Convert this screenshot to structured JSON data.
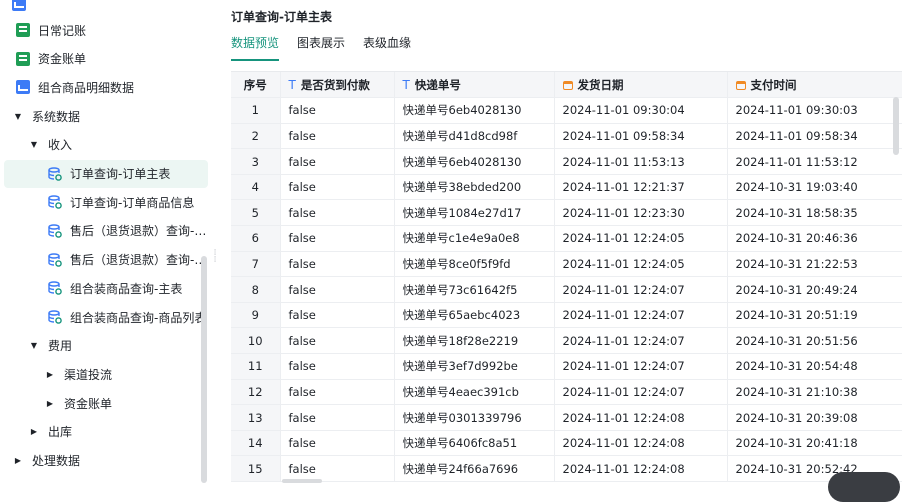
{
  "sidebar": {
    "items": [
      {
        "label": "日常记账",
        "icon": "sheet-icon",
        "caret": "",
        "level": 0,
        "selected": false
      },
      {
        "label": "资金账单",
        "icon": "sheet-icon",
        "caret": "",
        "level": 0,
        "selected": false
      },
      {
        "label": "组合商品明细数据",
        "icon": "chart-icon",
        "caret": "",
        "level": 0,
        "selected": false
      },
      {
        "label": "系统数据",
        "icon": "",
        "caret": "▼",
        "level": 0,
        "selected": false
      },
      {
        "label": "收入",
        "icon": "",
        "caret": "▼",
        "level": 1,
        "selected": false
      },
      {
        "label": "订单查询-订单主表",
        "icon": "db-icon",
        "caret": "",
        "level": 2,
        "selected": true
      },
      {
        "label": "订单查询-订单商品信息",
        "icon": "db-icon",
        "caret": "",
        "level": 2,
        "selected": false
      },
      {
        "label": "售后（退货退款）查询-退货单主表",
        "icon": "db-icon",
        "caret": "",
        "level": 2,
        "selected": false
      },
      {
        "label": "售后（退货退款）查询-退货商品信息",
        "icon": "db-icon",
        "caret": "",
        "level": 2,
        "selected": false
      },
      {
        "label": "组合装商品查询-主表",
        "icon": "db-icon",
        "caret": "",
        "level": 2,
        "selected": false
      },
      {
        "label": "组合装商品查询-商品列表",
        "icon": "db-icon",
        "caret": "",
        "level": 2,
        "selected": false
      },
      {
        "label": "费用",
        "icon": "",
        "caret": "▼",
        "level": 1,
        "selected": false
      },
      {
        "label": "渠道投流",
        "icon": "",
        "caret": "▶",
        "level": 2,
        "selected": false
      },
      {
        "label": "资金账单",
        "icon": "",
        "caret": "▶",
        "level": 2,
        "selected": false
      },
      {
        "label": "出库",
        "icon": "",
        "caret": "▶",
        "level": 1,
        "selected": false
      },
      {
        "label": "处理数据",
        "icon": "",
        "caret": "▶",
        "level": 0,
        "selected": false
      }
    ]
  },
  "main": {
    "title": "订单查询-订单主表",
    "tabs": [
      {
        "label": "数据预览",
        "active": true
      },
      {
        "label": "图表展示",
        "active": false
      },
      {
        "label": "表级血缘",
        "active": false
      }
    ]
  },
  "table": {
    "columns": [
      {
        "label": "序号",
        "type": ""
      },
      {
        "label": "是否货到付款",
        "type": "text"
      },
      {
        "label": "快递单号",
        "type": "text"
      },
      {
        "label": "发货日期",
        "type": "date"
      },
      {
        "label": "支付时间",
        "type": "date"
      }
    ],
    "rows": [
      [
        "1",
        "false",
        "快递单号6eb4028130",
        "2024-11-01 09:30:04",
        "2024-11-01 09:30:03"
      ],
      [
        "2",
        "false",
        "快递单号d41d8cd98f",
        "2024-11-01 09:58:34",
        "2024-11-01 09:58:34"
      ],
      [
        "3",
        "false",
        "快递单号6eb4028130",
        "2024-11-01 11:53:13",
        "2024-11-01 11:53:12"
      ],
      [
        "4",
        "false",
        "快递单号38ebded200",
        "2024-11-01 12:21:37",
        "2024-10-31 19:03:40"
      ],
      [
        "5",
        "false",
        "快递单号1084e27d17",
        "2024-11-01 12:23:30",
        "2024-10-31 18:58:35"
      ],
      [
        "6",
        "false",
        "快递单号c1e4e9a0e8",
        "2024-11-01 12:24:05",
        "2024-10-31 20:46:36"
      ],
      [
        "7",
        "false",
        "快递单号8ce0f5f9fd",
        "2024-11-01 12:24:05",
        "2024-10-31 21:22:53"
      ],
      [
        "8",
        "false",
        "快递单号73c61642f5",
        "2024-11-01 12:24:07",
        "2024-10-31 20:49:24"
      ],
      [
        "9",
        "false",
        "快递单号65aebc4023",
        "2024-11-01 12:24:07",
        "2024-10-31 20:51:19"
      ],
      [
        "10",
        "false",
        "快递单号18f28e2219",
        "2024-11-01 12:24:07",
        "2024-10-31 20:51:56"
      ],
      [
        "11",
        "false",
        "快递单号3ef7d992be",
        "2024-11-01 12:24:07",
        "2024-10-31 20:54:48"
      ],
      [
        "12",
        "false",
        "快递单号4eaec391cb",
        "2024-11-01 12:24:07",
        "2024-10-31 21:10:38"
      ],
      [
        "13",
        "false",
        "快递单号0301339796",
        "2024-11-01 12:24:08",
        "2024-10-31 20:39:08"
      ],
      [
        "14",
        "false",
        "快递单号6406fc8a51",
        "2024-11-01 12:24:08",
        "2024-10-31 20:41:18"
      ],
      [
        "15",
        "false",
        "快递单号24f66a7696",
        "2024-11-01 12:24:08",
        "2024-10-31 20:52:42"
      ]
    ]
  },
  "colors": {
    "accent": "#16947d",
    "selected_bg": "#ecf6f3",
    "sheet_icon": "#1f9d55",
    "chart_icon": "#3d7bf6",
    "date_icon": "#f08a24"
  }
}
